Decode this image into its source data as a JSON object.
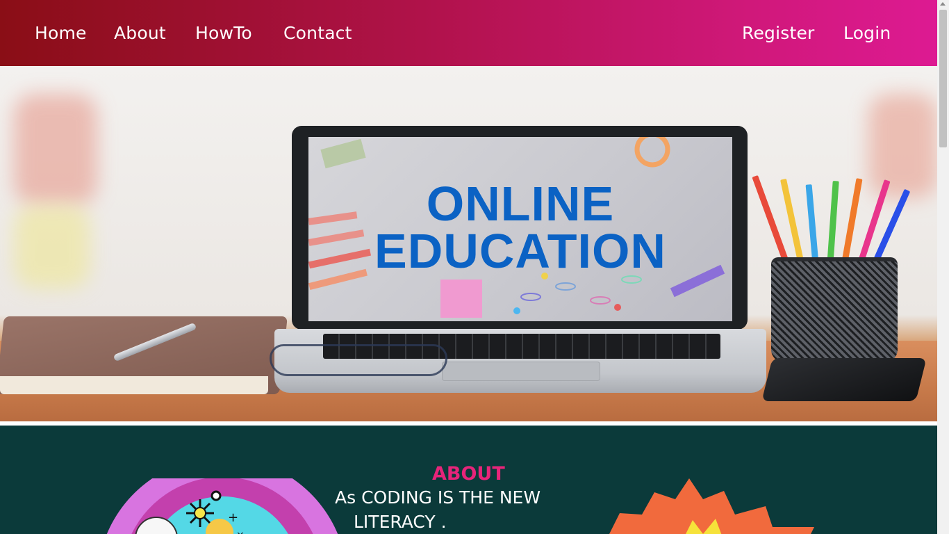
{
  "nav": {
    "left_links": [
      "Home",
      "About",
      "HowTo",
      "Contact"
    ],
    "right_links": [
      "Register",
      "Login"
    ]
  },
  "hero": {
    "screen_line1": "ONLINE",
    "screen_line2": "EDUCATION"
  },
  "about": {
    "heading": "ABOUT",
    "text_line1": "As CODING IS THE NEW",
    "text_line2": "LITERACY ."
  },
  "colors": {
    "nav_gradient_start": "#8a0e16",
    "nav_gradient_end": "#dd1a92",
    "about_background": "#0b3a3a",
    "about_heading": "#e7247a",
    "screen_title": "#0b62c4"
  }
}
